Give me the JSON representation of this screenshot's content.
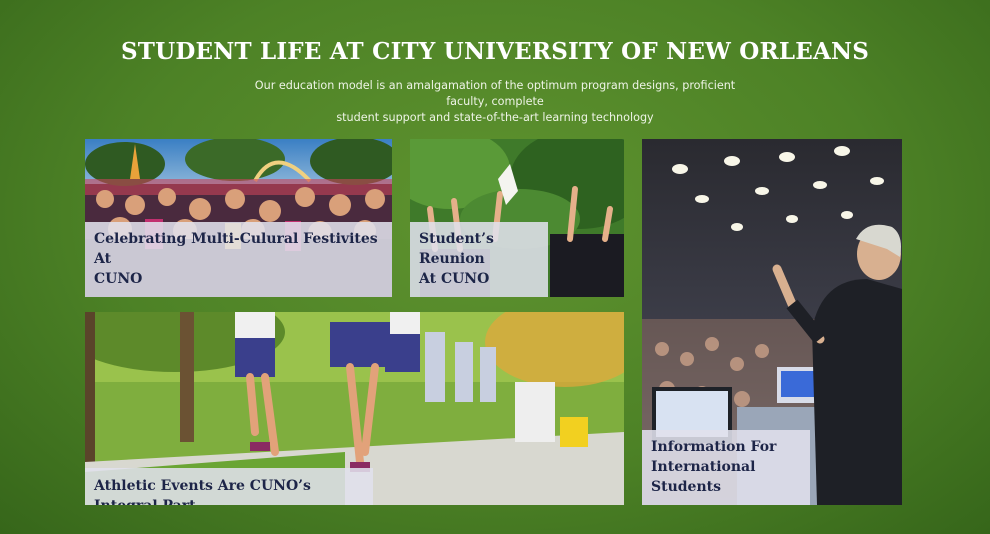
{
  "section": {
    "title": "STUDENT LIFE AT CITY UNIVERSITY OF NEW ORLEANS",
    "subtitle_line1": "Our education model is an amalgamation of the optimum program designs, proficient faculty, complete",
    "subtitle_line2": "student support and state-of-the-art learning technology"
  },
  "cards": {
    "festival": {
      "caption_line1": "Celebrating Multi-Culural Festivites At",
      "caption_line2": "CUNO"
    },
    "reunion": {
      "caption_line1": "Student’s Reunion",
      "caption_line2": "At CUNO"
    },
    "athletic": {
      "caption_line1": "Athletic Events Are CUNO’s Integral Part"
    },
    "international": {
      "caption_line1": "Information For",
      "caption_line2": "International Students"
    }
  },
  "colors": {
    "background": "#4d8226",
    "caption_text": "#1d2548",
    "caption_bg": "#e0e0ec"
  }
}
